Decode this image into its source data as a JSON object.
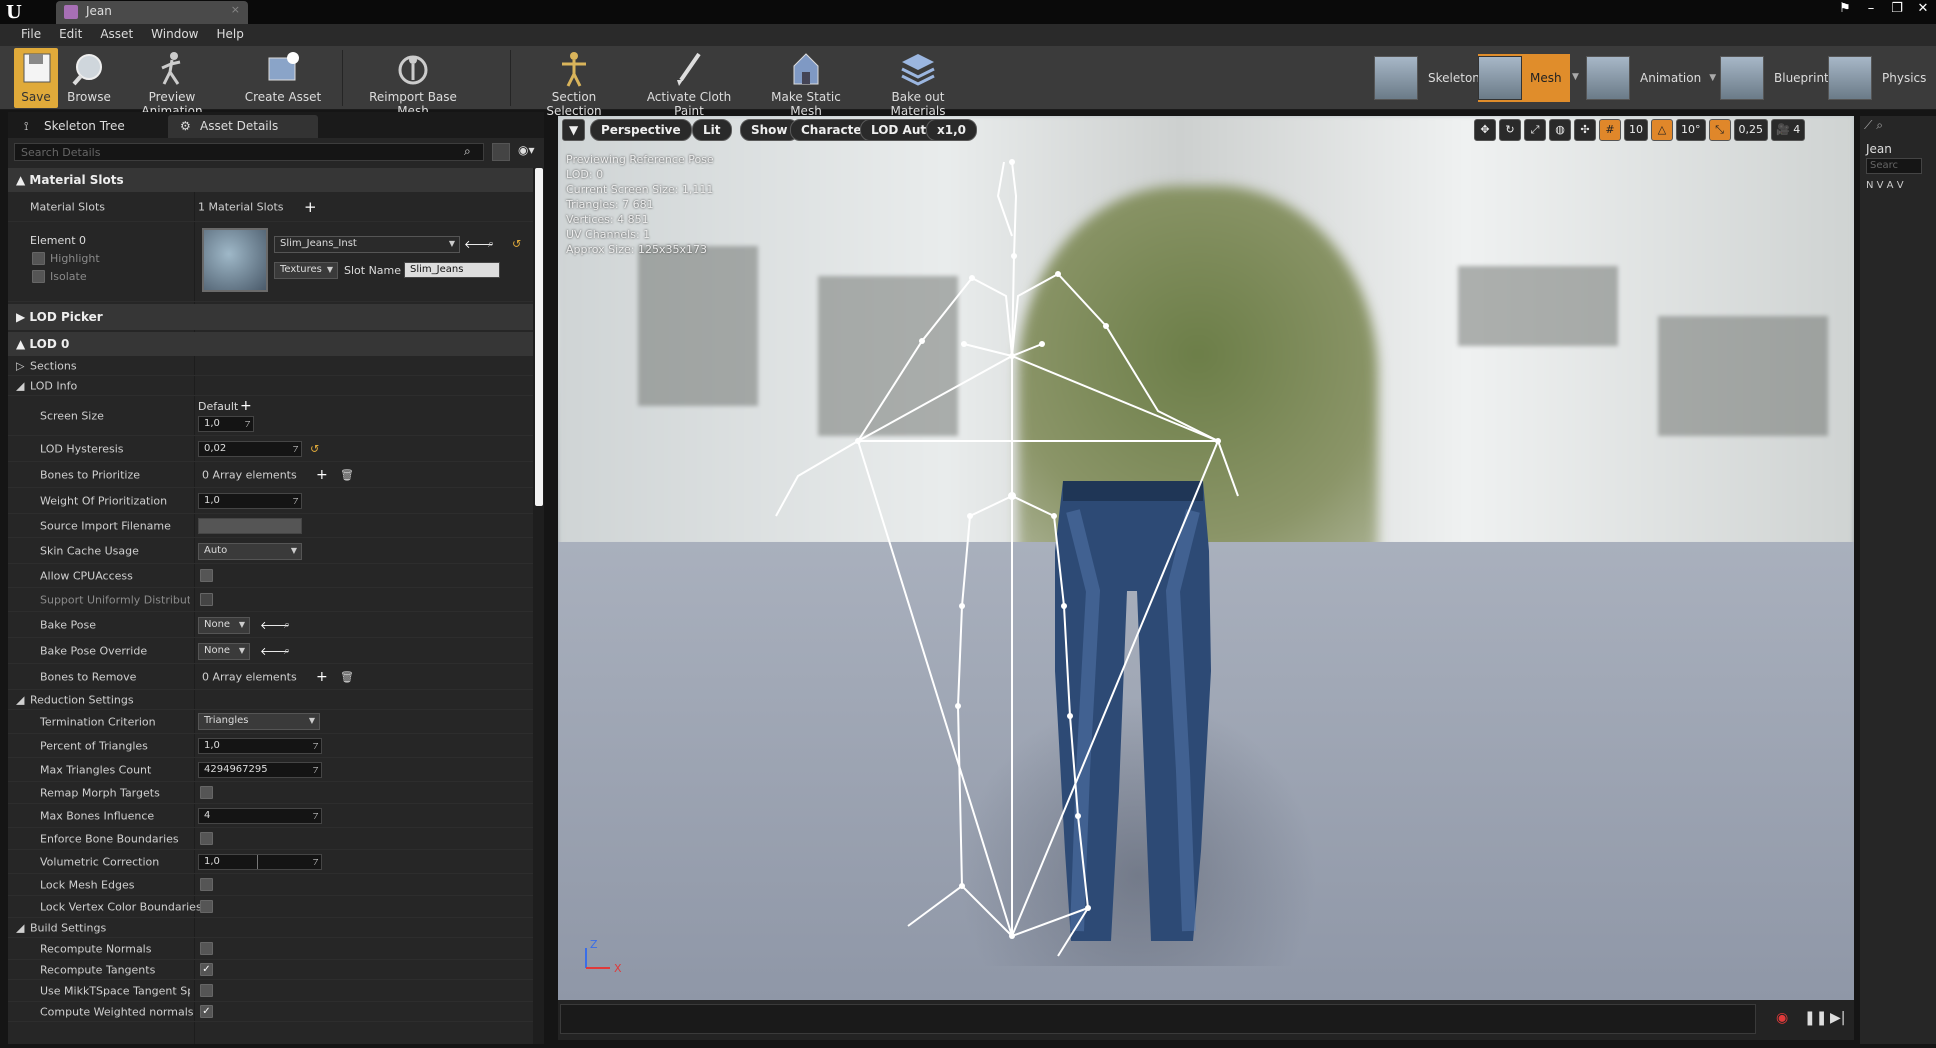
{
  "window": {
    "tab_title": "Jean",
    "tab_close": "×"
  },
  "menu": [
    "File",
    "Edit",
    "Asset",
    "Window",
    "Help"
  ],
  "toolbar": {
    "save": "Save",
    "browse": "Browse",
    "preview_animation": "Preview Animation",
    "create_asset": "Create Asset",
    "reimport": "Reimport Base Mesh",
    "section_selection": "Section Selection",
    "cloth_paint": "Activate Cloth Paint",
    "static_mesh": "Make Static Mesh",
    "bake_materials": "Bake out Materials"
  },
  "modes": {
    "skeleton": "Skeleton",
    "mesh": "Mesh",
    "animation": "Animation",
    "blueprint": "Blueprint",
    "physics": "Physics"
  },
  "panel_tabs": {
    "skeleton_tree": "Skeleton Tree",
    "asset_details": "Asset Details"
  },
  "search": {
    "placeholder": "Search Details"
  },
  "details": {
    "material_slots_header": "Material Slots",
    "material_slots_label": "Material Slots",
    "material_slots_value": "1 Material Slots",
    "element0": "Element 0",
    "highlight": "Highlight",
    "isolate": "Isolate",
    "material_name": "Slim_Jeans_Inst",
    "textures": "Textures",
    "slot_name_label": "Slot Name",
    "slot_name_value": "Slim_Jeans",
    "lod_picker": "LOD Picker",
    "lod0": "LOD 0",
    "sections": "Sections",
    "lod_info": "LOD Info",
    "screen_size": "Screen Size",
    "screen_default": "Default",
    "screen_size_value": "1,0",
    "lod_hysteresis": "LOD Hysteresis",
    "lod_hysteresis_value": "0,02",
    "bones_prioritize": "Bones to Prioritize",
    "array0": "0 Array elements",
    "weight_prior": "Weight Of Prioritization",
    "weight_prior_value": "1,0",
    "source_import": "Source Import Filename",
    "skin_cache": "Skin Cache Usage",
    "skin_cache_value": "Auto",
    "allow_cpu": "Allow CPUAccess",
    "support_uniform": "Support Uniformly Distributed S",
    "bake_pose": "Bake Pose",
    "none": "None",
    "bake_pose_override": "Bake Pose Override",
    "bones_remove": "Bones to Remove",
    "reduction": "Reduction Settings",
    "termination": "Termination Criterion",
    "termination_value": "Triangles",
    "percent_tri": "Percent of Triangles",
    "percent_tri_value": "1,0",
    "max_tri": "Max Triangles Count",
    "max_tri_value": "4294967295",
    "remap_morph": "Remap Morph Targets",
    "max_bones": "Max Bones Influence",
    "max_bones_value": "4",
    "enforce_bone": "Enforce Bone Boundaries",
    "volumetric": "Volumetric Correction",
    "volumetric_value": "1,0",
    "lock_mesh": "Lock Mesh Edges",
    "lock_vertex": "Lock Vertex Color Boundaries",
    "build": "Build Settings",
    "recompute_normals": "Recompute Normals",
    "recompute_tangents": "Recompute Tangents",
    "mikkt": "Use MikkTSpace Tangent Spa",
    "weighted_normals": "Compute Weighted normals"
  },
  "viewport": {
    "perspective": "Perspective",
    "lit": "Lit",
    "show": "Show",
    "character": "Character",
    "lod_auto": "LOD Auto",
    "speed": "x1,0",
    "info": [
      "Previewing Reference Pose",
      "LOD: 0",
      "Current Screen Size: 1,111",
      "Triangles: 7 681",
      "Vertices: 4 851",
      "UV Channels: 1",
      "Approx Size: 125x35x173"
    ],
    "grid": "10",
    "rot": "10°",
    "scale": "0,25",
    "cam": "4",
    "axis_z": "Z",
    "axis_x": "X"
  },
  "right_panel": {
    "title": "Jean",
    "search": "Searc",
    "letters": "N V A V"
  },
  "colors": {
    "accent": "#e0872a",
    "save": "#e0aa3a",
    "panel": "#262626"
  }
}
